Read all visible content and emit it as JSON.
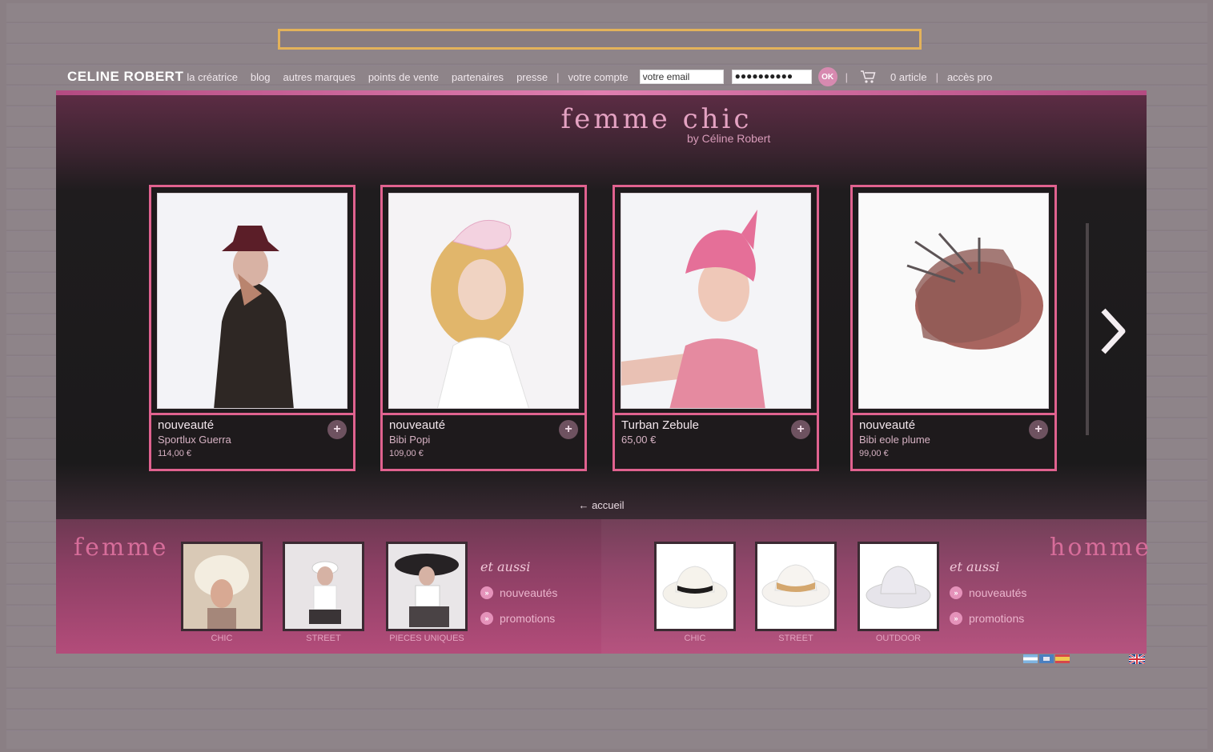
{
  "brand": "CELINE ROBERT",
  "nav": {
    "links": [
      "la créatrice",
      "blog",
      "autres marques",
      "points de vente",
      "partenaires",
      "presse"
    ],
    "account_label": "votre compte",
    "email_value": "votre email",
    "password_mask": "●●●●●●●●●●",
    "ok_label": "OK",
    "cart_label": "0 article",
    "pro_label": "accès pro"
  },
  "section": {
    "title": "femme chic",
    "subtitle": "by Céline Robert",
    "back_label": "← accueil"
  },
  "products": [
    {
      "tag": "nouveauté",
      "name": "Sportlux Guerra",
      "price": "114,00 €"
    },
    {
      "tag": "nouveauté",
      "name": "Bibi Popi",
      "price": "109,00 €"
    },
    {
      "tag": "Turban Zebule",
      "name": "65,00 €",
      "price": ""
    },
    {
      "tag": "nouveauté",
      "name": "Bibi eole plume",
      "price": "99,00 €"
    }
  ],
  "femme": {
    "title": "femme",
    "thumbs": [
      "CHIC",
      "STREET",
      "PIECES UNIQUES"
    ],
    "aussi_title": "et aussi",
    "aussi_items": [
      "nouveautés",
      "promotions"
    ]
  },
  "homme": {
    "title": "homme",
    "thumbs": [
      "CHIC",
      "STREET",
      "OUTDOOR"
    ],
    "aussi_title": "et aussi",
    "aussi_items": [
      "nouveautés",
      "promotions"
    ]
  },
  "colors": {
    "accent_pink": "#e0628f",
    "panel_dark": "#1b1a1b",
    "bottom_band": "#b34c7a"
  }
}
